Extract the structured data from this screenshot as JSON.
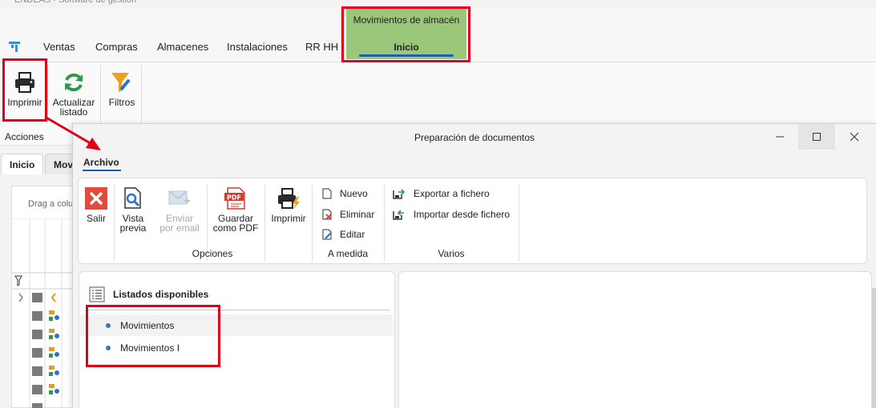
{
  "app": {
    "title": "ENDEAS - Software de gestión"
  },
  "menu": {
    "items": [
      "Ventas",
      "Compras",
      "Almacenes",
      "Instalaciones",
      "RR HH"
    ],
    "context_group": "Movimientos de almacén",
    "context_tab": "Inicio"
  },
  "ribbon": {
    "imprimir": "Imprimir",
    "actualizar_1": "Actualizar",
    "actualizar_2": "listado",
    "filtros": "Filtros",
    "group_label": "Acciones"
  },
  "tabs": {
    "inicio": "Inicio",
    "mov": "Mov"
  },
  "grid": {
    "drag_hint": "Drag a colu"
  },
  "dialog": {
    "title": "Preparación de documentos",
    "archivo_tab": "Archivo",
    "buttons": {
      "salir": "Salir",
      "vista_1": "Vista",
      "vista_2": "previa",
      "enviar_1": "Enviar",
      "enviar_2": "por email",
      "guardar_1": "Guardar",
      "guardar_2": "como PDF",
      "imprimir": "Imprimir",
      "nuevo": "Nuevo",
      "eliminar": "Eliminar",
      "editar": "Editar",
      "exportar": "Exportar a fichero",
      "importar": "Importar desde fichero"
    },
    "groups": {
      "opciones": "Opciones",
      "a_medida": "A medida",
      "varios": "Varios"
    },
    "listados": {
      "heading": "Listados disponibles",
      "items": [
        "Movimientos",
        "Movimientos I"
      ]
    }
  },
  "colors": {
    "context_tab_bg": "#9bc77a",
    "accent": "#1f5fa8",
    "highlight": "#e0001a",
    "bullet": "#4a6fb5"
  }
}
